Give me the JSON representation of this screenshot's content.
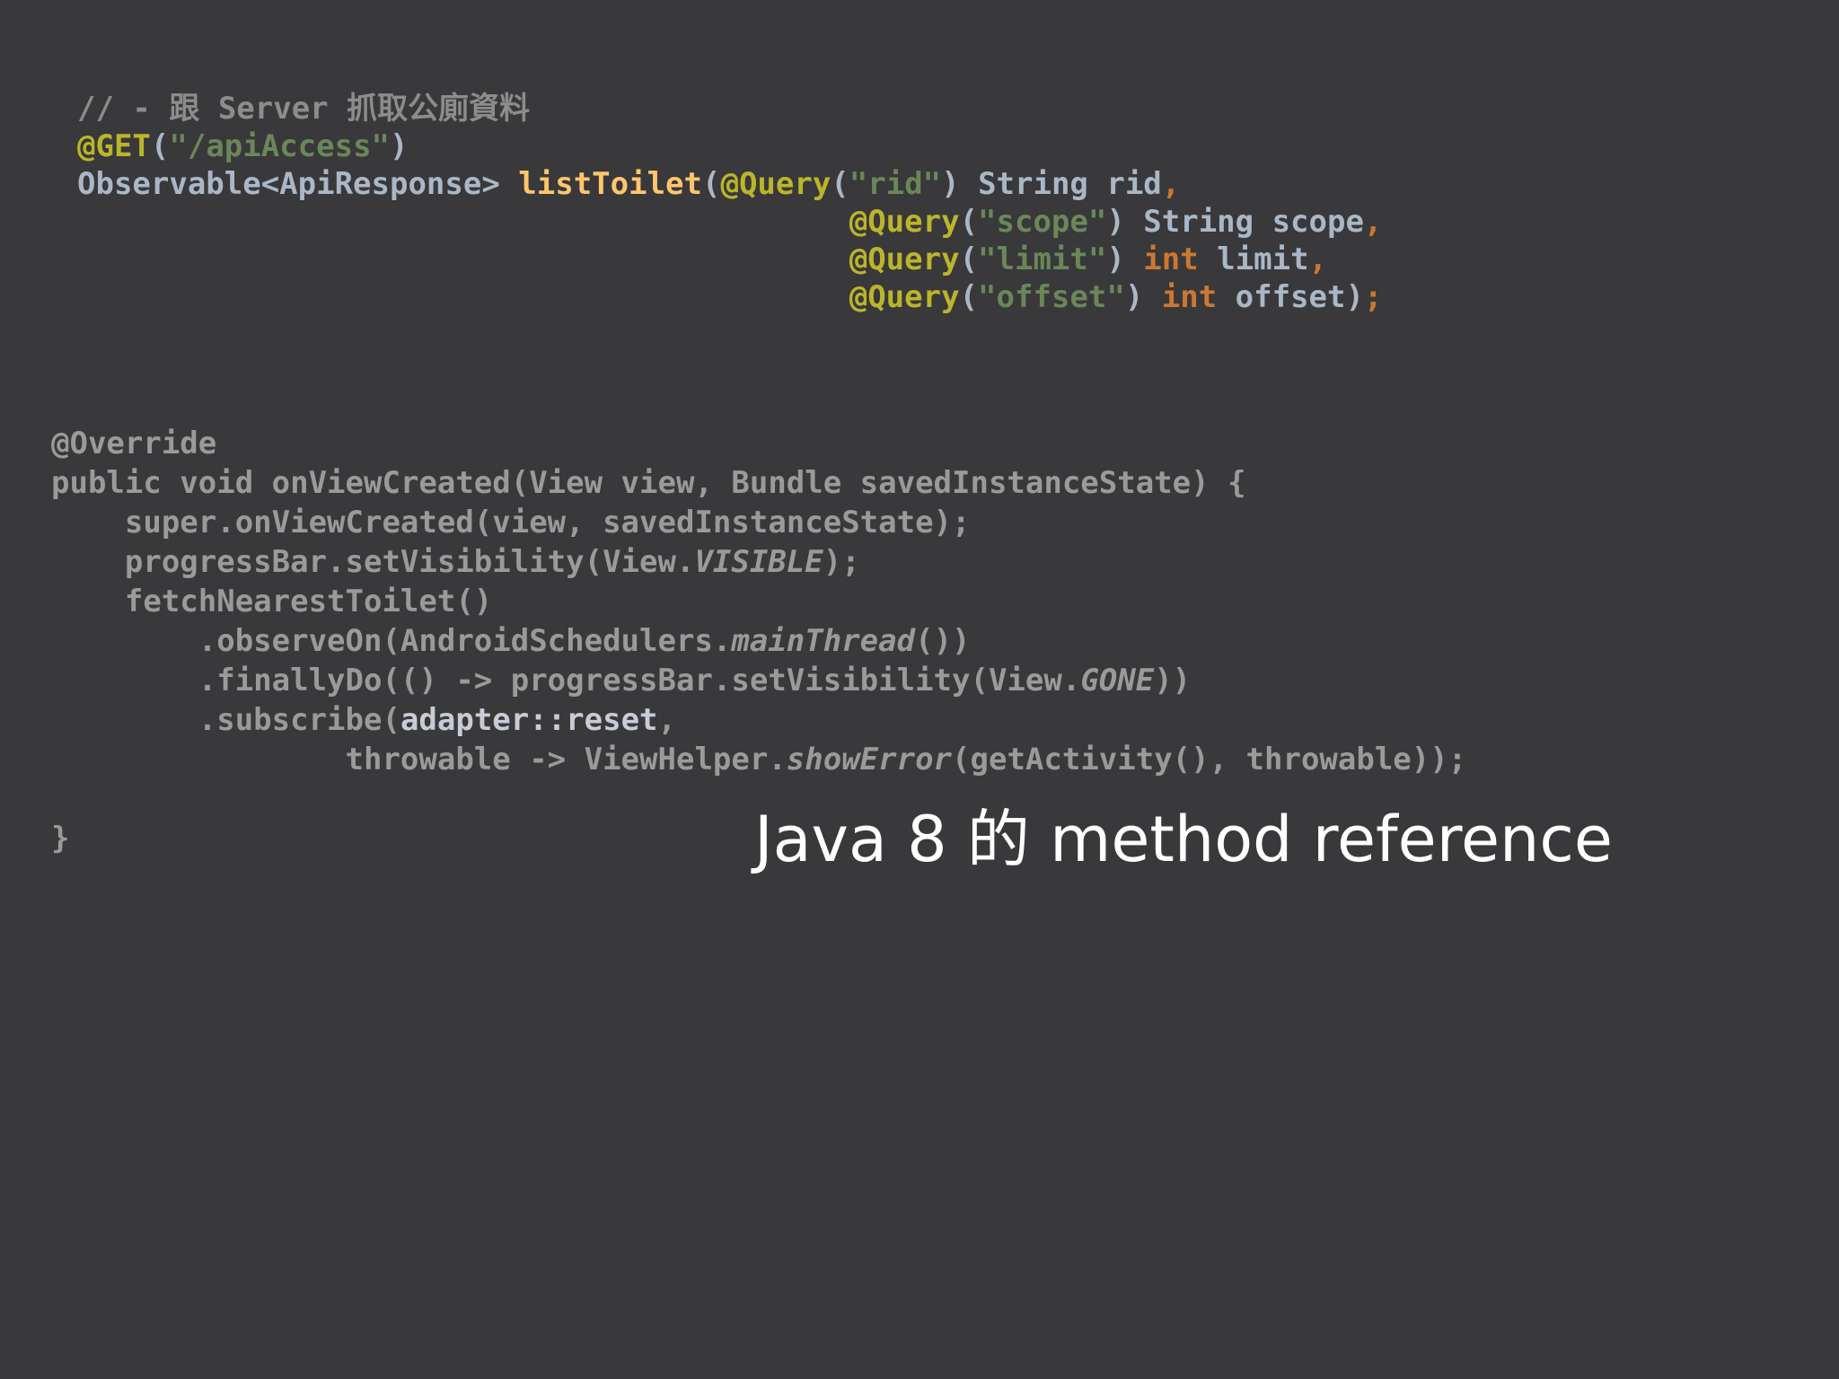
{
  "slide": {
    "caption": "Java 8 的 method reference"
  },
  "colors": {
    "background": "#39383b",
    "comment": "#8c8c8c",
    "annotation": "#bbb529",
    "string": "#6a8759",
    "keyword": "#cc7832",
    "method": "#ffc66d",
    "plain": "#a9b7c6",
    "dimmed": "#9a9a9a",
    "highlight": "#c7ccd6",
    "caption": "#ffffff"
  },
  "code1": {
    "lines": [
      [
        {
          "t": "// - 跟 Server 抓取公廁資料",
          "c": "comment"
        }
      ],
      [
        {
          "t": "@GET",
          "c": "anno"
        },
        {
          "t": "(",
          "c": "plain"
        },
        {
          "t": "\"/apiAccess\"",
          "c": "str"
        },
        {
          "t": ")",
          "c": "plain"
        }
      ],
      [
        {
          "t": "Observable<ApiResponse> ",
          "c": "plain"
        },
        {
          "t": "listToilet",
          "c": "fn"
        },
        {
          "t": "(",
          "c": "plain"
        },
        {
          "t": "@Query",
          "c": "anno"
        },
        {
          "t": "(",
          "c": "plain"
        },
        {
          "t": "\"rid\"",
          "c": "str"
        },
        {
          "t": ") String rid",
          "c": "plain"
        },
        {
          "t": ",",
          "c": "kw"
        }
      ],
      [
        {
          "t": "                                          ",
          "c": "plain"
        },
        {
          "t": "@Query",
          "c": "anno"
        },
        {
          "t": "(",
          "c": "plain"
        },
        {
          "t": "\"scope\"",
          "c": "str"
        },
        {
          "t": ") String scope",
          "c": "plain"
        },
        {
          "t": ",",
          "c": "kw"
        }
      ],
      [
        {
          "t": "                                          ",
          "c": "plain"
        },
        {
          "t": "@Query",
          "c": "anno"
        },
        {
          "t": "(",
          "c": "plain"
        },
        {
          "t": "\"limit\"",
          "c": "str"
        },
        {
          "t": ") ",
          "c": "plain"
        },
        {
          "t": "int",
          "c": "kw"
        },
        {
          "t": " limit",
          "c": "plain"
        },
        {
          "t": ",",
          "c": "kw"
        }
      ],
      [
        {
          "t": "                                          ",
          "c": "plain"
        },
        {
          "t": "@Query",
          "c": "anno"
        },
        {
          "t": "(",
          "c": "plain"
        },
        {
          "t": "\"offset\"",
          "c": "str"
        },
        {
          "t": ") ",
          "c": "plain"
        },
        {
          "t": "int",
          "c": "kw"
        },
        {
          "t": " offset)",
          "c": "plain"
        },
        {
          "t": ";",
          "c": "kw"
        }
      ]
    ]
  },
  "code2": {
    "lines": [
      [
        {
          "t": "@Override",
          "c": "gray"
        }
      ],
      [
        {
          "t": "public void onViewCreated(View view, Bundle savedInstanceState) {",
          "c": "gray"
        }
      ],
      [
        {
          "t": "    super.onViewCreated(view, savedInstanceState);",
          "c": "gray"
        }
      ],
      [
        {
          "t": "    progressBar.setVisibility(View.",
          "c": "gray"
        },
        {
          "t": "VISIBLE",
          "c": "gray",
          "i": true
        },
        {
          "t": ");",
          "c": "gray"
        }
      ],
      [
        {
          "t": "    fetchNearestToilet()",
          "c": "gray"
        }
      ],
      [
        {
          "t": "        .observeOn(AndroidSchedulers.",
          "c": "gray"
        },
        {
          "t": "mainThread",
          "c": "gray",
          "i": true
        },
        {
          "t": "())",
          "c": "gray"
        }
      ],
      [
        {
          "t": "        .finallyDo(() -> progressBar.setVisibility(View.",
          "c": "gray"
        },
        {
          "t": "GONE",
          "c": "gray",
          "i": true
        },
        {
          "t": "))",
          "c": "gray"
        }
      ],
      [
        {
          "t": "        .subscribe(",
          "c": "gray"
        },
        {
          "t": "adapter::reset",
          "c": "bright"
        },
        {
          "t": ",",
          "c": "gray"
        }
      ],
      [
        {
          "t": "                throwable -> ViewHelper.",
          "c": "gray"
        },
        {
          "t": "showError",
          "c": "gray",
          "i": true
        },
        {
          "t": "(getActivity(), throwable));",
          "c": "gray"
        }
      ],
      [
        {
          "t": "",
          "c": "gray"
        }
      ],
      [
        {
          "t": "}",
          "c": "gray"
        }
      ]
    ]
  }
}
